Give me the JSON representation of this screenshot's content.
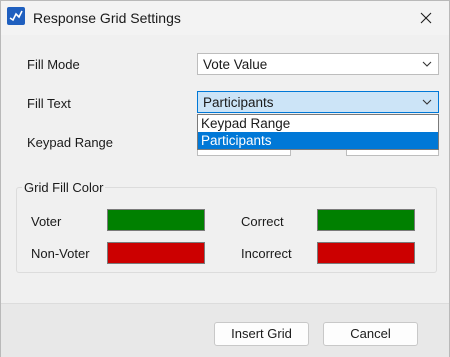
{
  "window": {
    "title": "Response Grid Settings"
  },
  "form": {
    "fill_mode": {
      "label": "Fill Mode",
      "value": "Vote Value"
    },
    "fill_text": {
      "label": "Fill Text",
      "value": "Participants",
      "options": [
        "Keypad Range",
        "Participants"
      ],
      "selected_option": "Participants"
    },
    "keypad_range": {
      "label": "Keypad Range"
    }
  },
  "grid_fill_color": {
    "title": "Grid Fill Color",
    "voter": {
      "label": "Voter",
      "color": "#008000"
    },
    "non_voter": {
      "label": "Non-Voter",
      "color": "#cc0000"
    },
    "correct": {
      "label": "Correct",
      "color": "#008000"
    },
    "incorrect": {
      "label": "Incorrect",
      "color": "#cc0000"
    }
  },
  "buttons": {
    "insert_grid": "Insert Grid",
    "cancel": "Cancel"
  }
}
